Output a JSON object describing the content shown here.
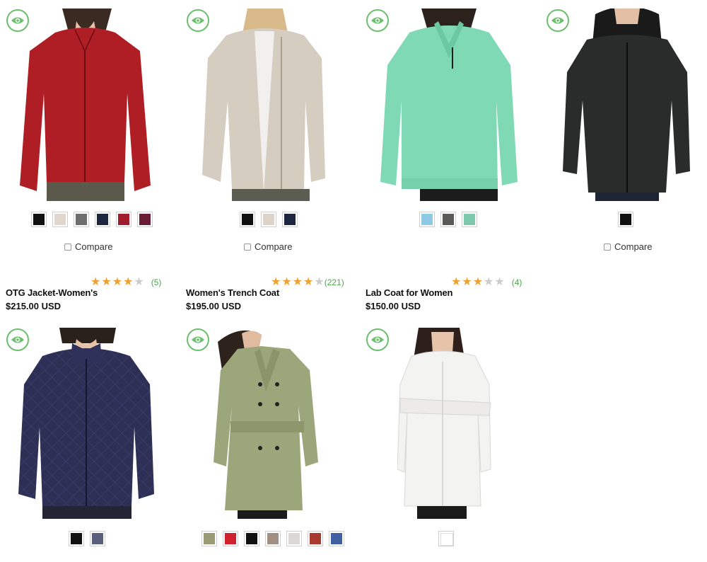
{
  "colors": {
    "accent_green": "#6cbf6c",
    "star_filled": "#f0a030",
    "star_empty": "#cccccc",
    "count_green": "#4aa84a"
  },
  "icons": {
    "quick_view": "eye-icon"
  },
  "compare_label": "Compare",
  "row1": [
    {
      "swatches": [
        "#111111",
        "#e0d6cc",
        "#6e6e6e",
        "#1e2740",
        "#a11c2c",
        "#6a1e35"
      ],
      "show_compare": true
    },
    {
      "swatches": [
        "#111111",
        "#ddd3c6",
        "#1e2740"
      ],
      "show_compare": true
    },
    {
      "swatches": [
        "#8ecae6",
        "#5a5a58",
        "#7ec9ae"
      ],
      "show_compare": false
    },
    {
      "swatches": [
        "#111111"
      ],
      "show_compare": true
    }
  ],
  "row2": [
    {
      "title": "OTG Jacket-Women's",
      "price": "$215.00 USD",
      "rating": 4,
      "reviews": "(5)",
      "swatches": [
        "#111111",
        "#5c5e7e"
      ]
    },
    {
      "title": "Women's Trench Coat",
      "price": "$195.00 USD",
      "rating": 4,
      "reviews": "(221)",
      "swatches": [
        "#9a9a74",
        "#d1202e",
        "#111111",
        "#a18f82",
        "#d9d8d6",
        "#a83a30",
        "#3e5fa0"
      ]
    },
    {
      "title": "Lab Coat for Women",
      "price": "$150.00 USD",
      "rating": 3,
      "reviews": "(4)",
      "swatches": [
        "#ffffff"
      ]
    }
  ]
}
